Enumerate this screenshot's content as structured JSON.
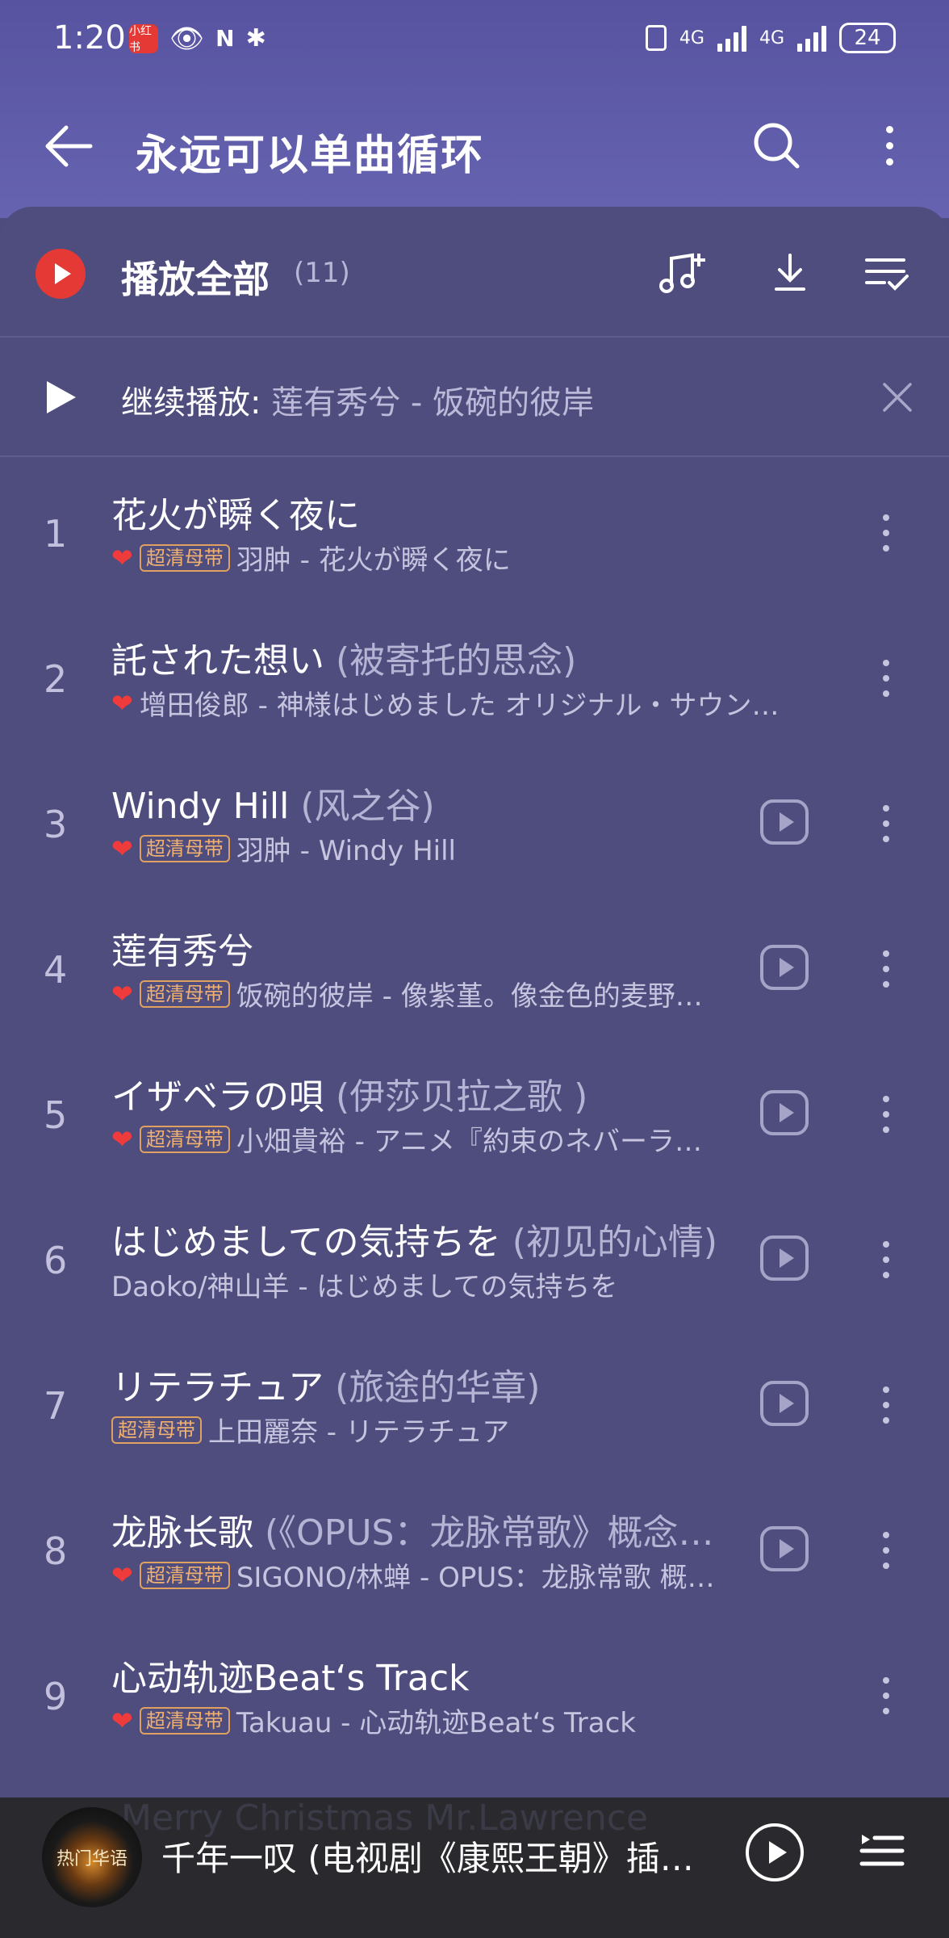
{
  "status_bar": {
    "time": "1:20",
    "app_badge": "小红书",
    "network": "4G",
    "battery": "24"
  },
  "header": {
    "title": "永远可以单曲循环",
    "back_icon": "back-arrow-icon",
    "search_icon": "search-icon",
    "more_icon": "more-vertical-icon"
  },
  "play_all": {
    "label": "播放全部",
    "count": "(11)"
  },
  "resume": {
    "label": "继续播放:",
    "track": "莲有秀兮 - 饭碗的彼岸"
  },
  "songs": [
    {
      "num": "1",
      "title": "花火が瞬く夜に",
      "alias": "",
      "liked": true,
      "tag": "超清母带",
      "meta": "羽肿 - 花火が瞬く夜に",
      "mv": false
    },
    {
      "num": "2",
      "title": "託された想い",
      "alias": "(被寄托的思念)",
      "liked": true,
      "tag": "",
      "meta": "增田俊郎 - 神様はじめました オリジナル・サウン…",
      "mv": false
    },
    {
      "num": "3",
      "title": "Windy Hill",
      "alias": "(风之谷)",
      "liked": true,
      "tag": "超清母带",
      "meta": "羽肿 - Windy Hill",
      "mv": true
    },
    {
      "num": "4",
      "title": "莲有秀兮",
      "alias": "",
      "liked": true,
      "tag": "超清母带",
      "meta": "饭碗的彼岸 - 像紫堇。像金色的麦野…",
      "mv": true
    },
    {
      "num": "5",
      "title": "イザベラの唄",
      "alias": "(伊莎贝拉之歌 )",
      "liked": true,
      "tag": "超清母带",
      "meta": "小畑貴裕 - アニメ『約束のネバーラ…",
      "mv": true
    },
    {
      "num": "6",
      "title": "はじめましての気持ちを",
      "alias": "(初见的心情)",
      "liked": false,
      "tag": "",
      "meta": "Daoko/神山羊 - はじめましての気持ちを",
      "mv": true
    },
    {
      "num": "7",
      "title": "リテラチュア",
      "alias": "(旅途的华章)",
      "liked": false,
      "tag": "超清母带",
      "meta": "上田麗奈 - リテラチュア",
      "mv": true
    },
    {
      "num": "8",
      "title": "龙脉长歌",
      "alias": "(《OPUS：龙脉常歌》概念…",
      "liked": true,
      "tag": "超清母带",
      "meta": "SIGONO/林蝉 - OPUS：龙脉常歌 概…",
      "mv": true
    },
    {
      "num": "9",
      "title": "心动轨迹Beat‘s Track",
      "alias": "",
      "liked": true,
      "tag": "超清母带",
      "meta": "Takuau - 心动轨迹Beat‘s Track",
      "mv": false
    }
  ],
  "player": {
    "ghost_text": "Merry Christmas Mr.Lawrence",
    "now_playing": "千年一叹 (电视剧《康熙王朝》插…",
    "cover_text": "热门华语"
  },
  "colors": {
    "accent_red": "#e53935",
    "heart_red": "#ef3b3b",
    "tag_gold": "#e0a060",
    "background": "#4f4d7e",
    "header": "#6663b0",
    "player_bar": "#2a2a2e"
  }
}
